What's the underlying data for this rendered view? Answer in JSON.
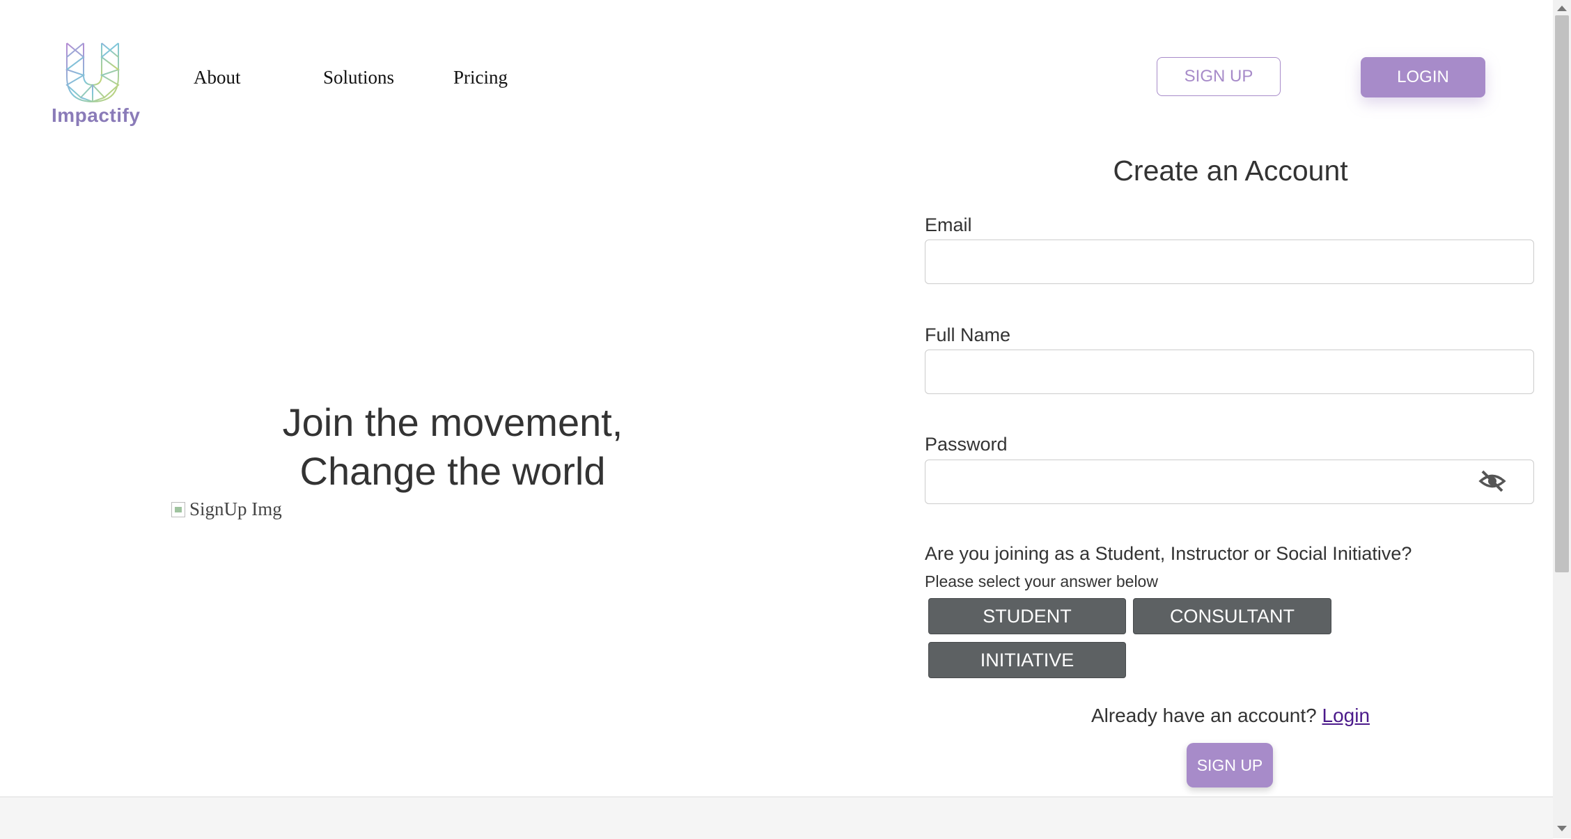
{
  "brand": {
    "name": "Impactify",
    "accent": "#a78bc9"
  },
  "nav": {
    "about": "About",
    "solutions": "Solutions",
    "pricing": "Pricing"
  },
  "header": {
    "signup_label": "SIGN UP",
    "login_label": "LOGIN"
  },
  "hero": {
    "line1": "Join the movement,",
    "line2": "Change the world",
    "image_alt": "SignUp Img"
  },
  "form": {
    "title": "Create an Account",
    "email_label": "Email",
    "email_value": "",
    "fullname_label": "Full Name",
    "fullname_value": "",
    "password_label": "Password",
    "password_value": "",
    "password_toggle_icon": "eye-off-icon",
    "question": "Are you joining as a Student, Instructor or Social Initiative?",
    "hint": "Please select your answer below",
    "roles": [
      "STUDENT",
      "CONSULTANT",
      "INITIATIVE"
    ],
    "already_text": "Already have an account?",
    "login_link": "Login",
    "submit_label": "SIGN UP"
  }
}
